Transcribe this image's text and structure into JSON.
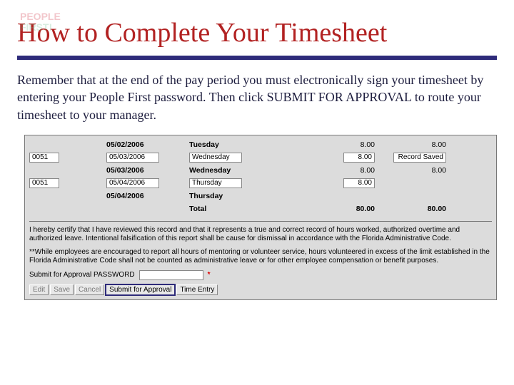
{
  "logo": {
    "line1": "PEOPLE",
    "line2": "FIRST!"
  },
  "title": "How to Complete Your Timesheet",
  "body": "Remember that at the end of the pay period you must electronically sign your timesheet by entering your People First password.  Then click SUBMIT FOR APPROVAL to route your timesheet to your manager.",
  "grid": {
    "summaryA": {
      "date": "05/02/2006",
      "day": "Tuesday",
      "h1": "8.00",
      "h2": "8.00"
    },
    "entryB": {
      "code": "0051",
      "date": "05/03/2006",
      "day": "Wednesday",
      "h1": "8.00",
      "status": "Record Saved"
    },
    "summaryB": {
      "date": "05/03/2006",
      "day": "Wednesday",
      "h1": "8.00",
      "h2": "8.00"
    },
    "entryC": {
      "code": "0051",
      "date": "05/04/2006",
      "day": "Thursday",
      "h1": "8.00"
    },
    "summaryC": {
      "date": "05/04/2006",
      "day": "Thursday"
    },
    "total": {
      "label": "Total",
      "h1": "80.00",
      "h2": "80.00"
    }
  },
  "cert1": "I hereby certify that I have reviewed this record and that it represents a true and correct record of hours worked, authorized overtime and authorized leave. Intentional falsification of this report shall be cause for dismissal in accordance with the Florida Administrative Code.",
  "cert2": "**While employees are encouraged to report all hours of mentoring or volunteer service, hours volunteered in excess of the limit established in the Florida Administrative Code shall not be counted as administrative leave or for other employee compensation or benefit purposes.",
  "pw_label": "Submit for Approval PASSWORD",
  "buttons": {
    "edit": "Edit",
    "save": "Save",
    "cancel": "Cancel",
    "submit": "Submit for Approval",
    "time": "Time Entry"
  }
}
